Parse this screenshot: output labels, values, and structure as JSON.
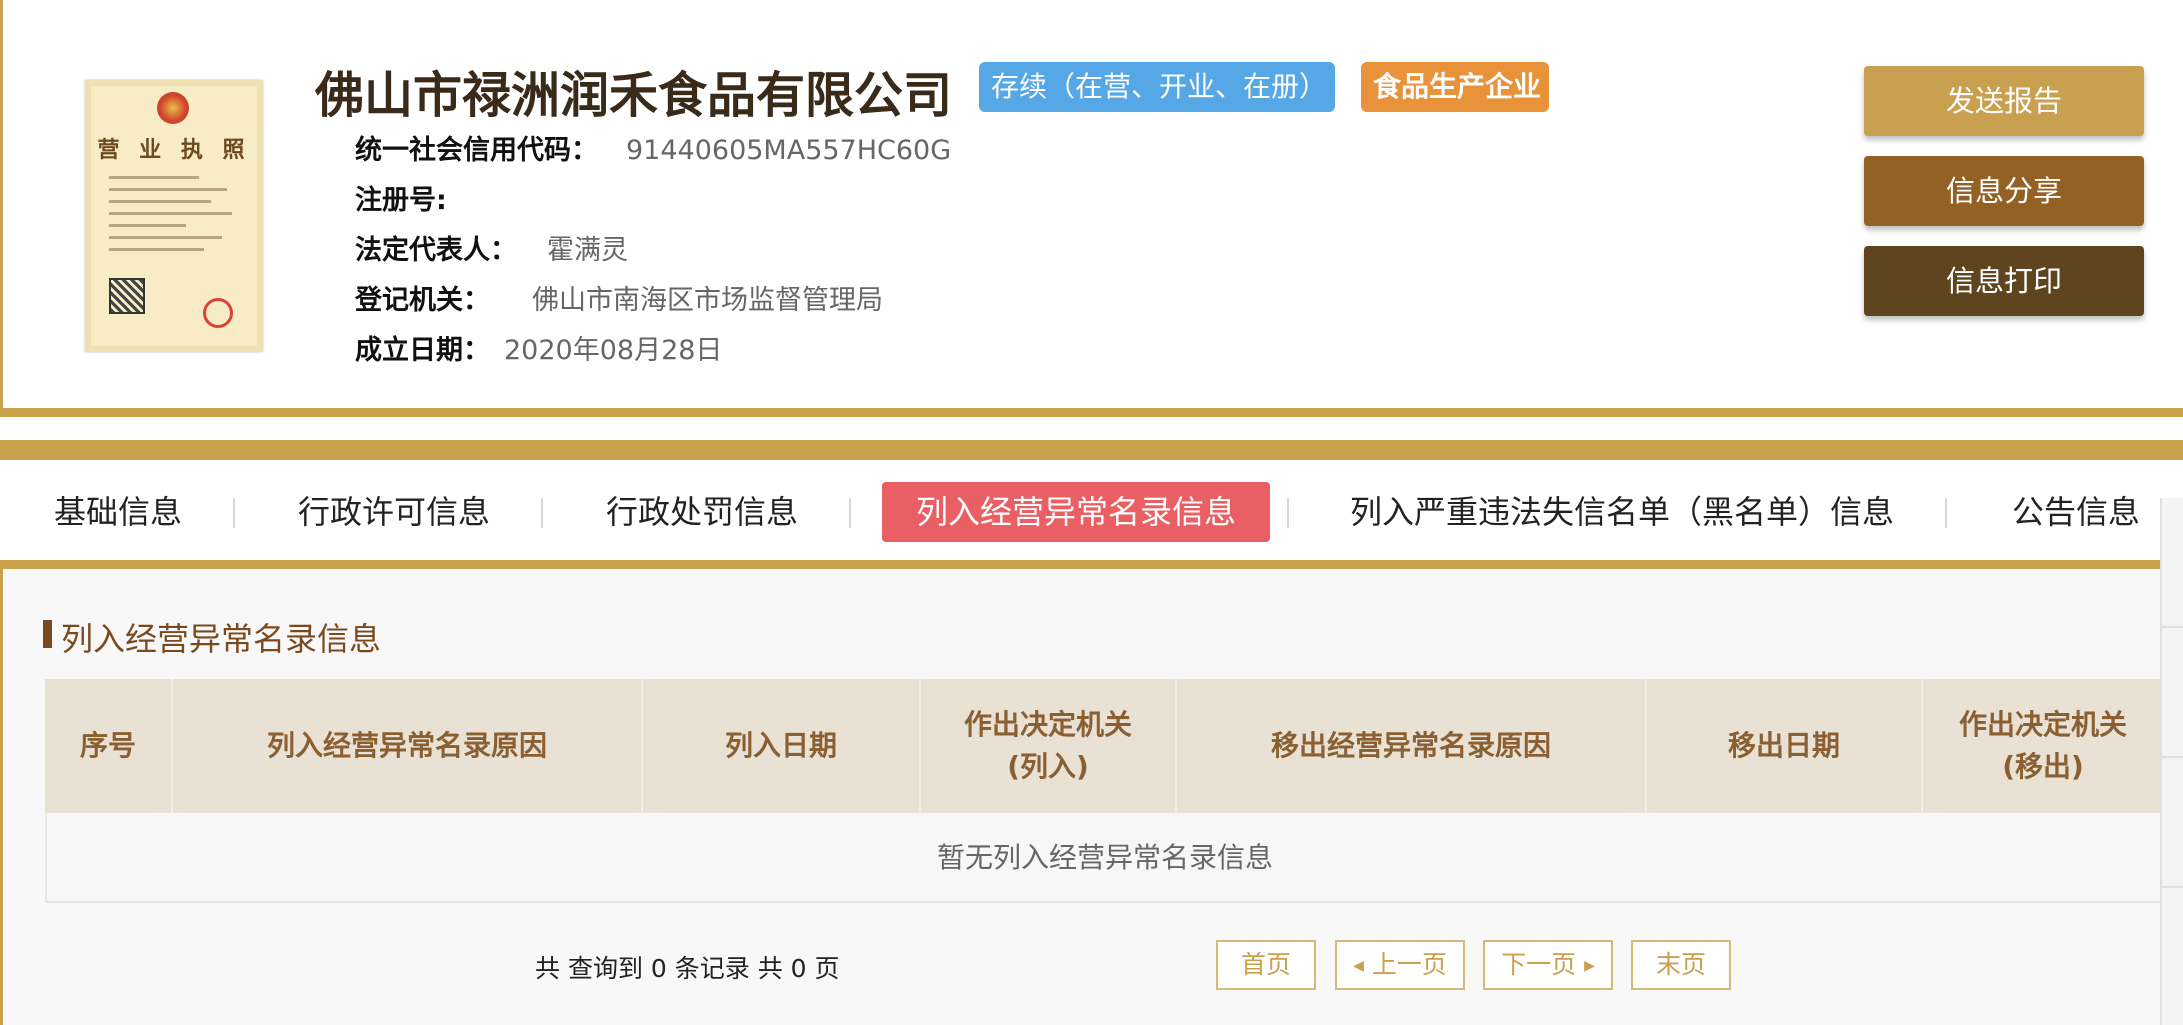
{
  "company": {
    "name": "佛山市禄洲润禾食品有限公司",
    "status_badge": "存续（在营、开业、在册）",
    "type_badge": "食品生产企业",
    "license_title": "营 业 执 照"
  },
  "info": [
    {
      "label": "统一社会信用代码：",
      "value": "91440605MA557HC60G"
    },
    {
      "label": "注册号:",
      "value": ""
    },
    {
      "label": "法定代表人：",
      "value": "霍满灵"
    },
    {
      "label": "登记机关：",
      "value": "佛山市南海区市场监督管理局"
    },
    {
      "label": "成立日期：",
      "value": "2020年08月28日"
    }
  ],
  "actions": {
    "report": "发送报告",
    "share": "信息分享",
    "print": "信息打印"
  },
  "tabs": [
    {
      "label": "基础信息"
    },
    {
      "label": "行政许可信息"
    },
    {
      "label": "行政处罚信息"
    },
    {
      "label": "列入经营异常名录信息"
    },
    {
      "label": "列入严重违法失信名单（黑名单）信息"
    },
    {
      "label": "公告信息"
    }
  ],
  "section": {
    "title": "列入经营异常名录信息",
    "columns": [
      "序号",
      "列入经营异常名录原因",
      "列入日期",
      "作出决定机关\n(列入)",
      "移出经营异常名录原因",
      "移出日期",
      "作出决定机关\n(移出)"
    ],
    "empty_text": "暂无列入经营异常名录信息"
  },
  "pager": {
    "summary": "共 查询到 0 条记录 共 0 页",
    "first": "首页",
    "prev": "上一页",
    "next": "下一页",
    "last": "末页"
  },
  "colors": {
    "gold": "#c9a04b",
    "active_tab": "#ea5f63",
    "status_badge": "#56a7e5",
    "type_badge": "#e8923a"
  }
}
